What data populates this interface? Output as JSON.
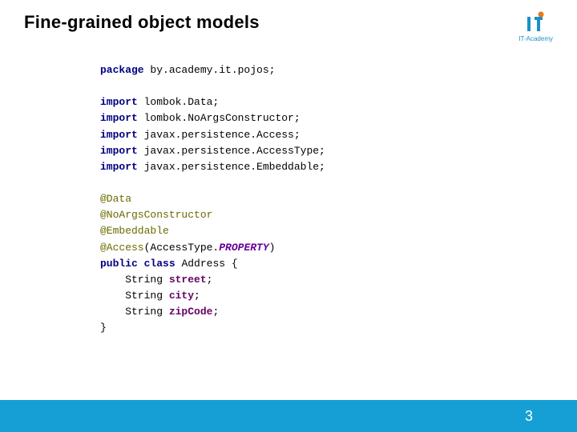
{
  "title": "Fine-grained object models",
  "logo_label": "IT-Academy",
  "code": {
    "kw_package": "package",
    "package_name": " by.academy.it.pojos;",
    "kw_import": "import",
    "imp1": " lombok.Data;",
    "imp2": " lombok.NoArgsConstructor;",
    "imp3": " javax.persistence.Access;",
    "imp4": " javax.persistence.AccessType;",
    "imp5": " javax.persistence.Embeddable;",
    "ann_data": "@Data",
    "ann_noargs": "@NoArgsConstructor",
    "ann_embed": "@Embeddable",
    "ann_access": "@Access",
    "access_paren_open": "(",
    "access_type": "AccessType.",
    "access_prop": "PROPERTY",
    "access_paren_close": ")",
    "kw_public": "public",
    "kw_class": "class",
    "class_name": " Address {",
    "type_string": "    String ",
    "field_street": "street",
    "field_city": "city",
    "field_zip": "zipCode",
    "semi": ";",
    "brace_close": "}"
  },
  "page_number": "3"
}
